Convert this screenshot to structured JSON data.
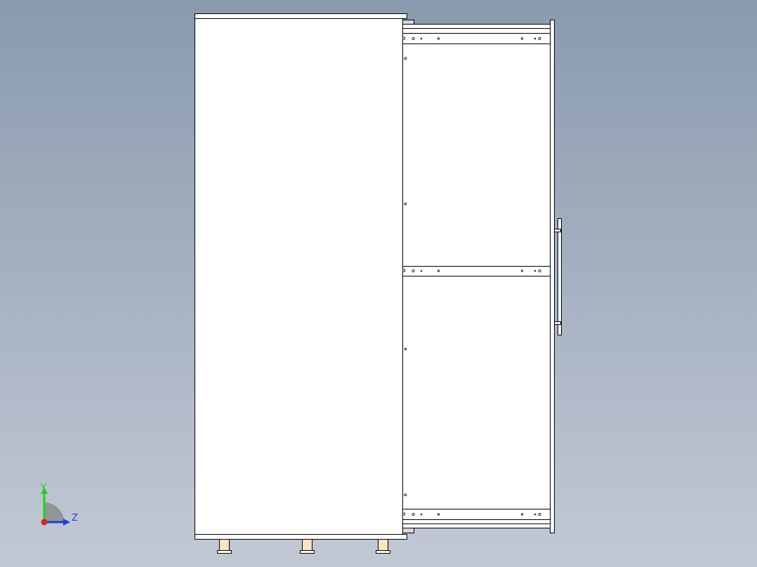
{
  "viewport": {
    "background_top": "#8a9aae",
    "background_bottom": "#c2c9d4"
  },
  "model": {
    "part_fill": "#ffffff",
    "edge_color": "#000000",
    "frame_edge_fill": "#d8d8d8",
    "foot_fill": "#fde4c0"
  },
  "triad": {
    "y_label": "Y",
    "z_label": "Z",
    "y_color": "#1fd21f",
    "z_color": "#1f3fd8",
    "x_color": "#e0201f",
    "sector_color": "#8c8c8c"
  }
}
